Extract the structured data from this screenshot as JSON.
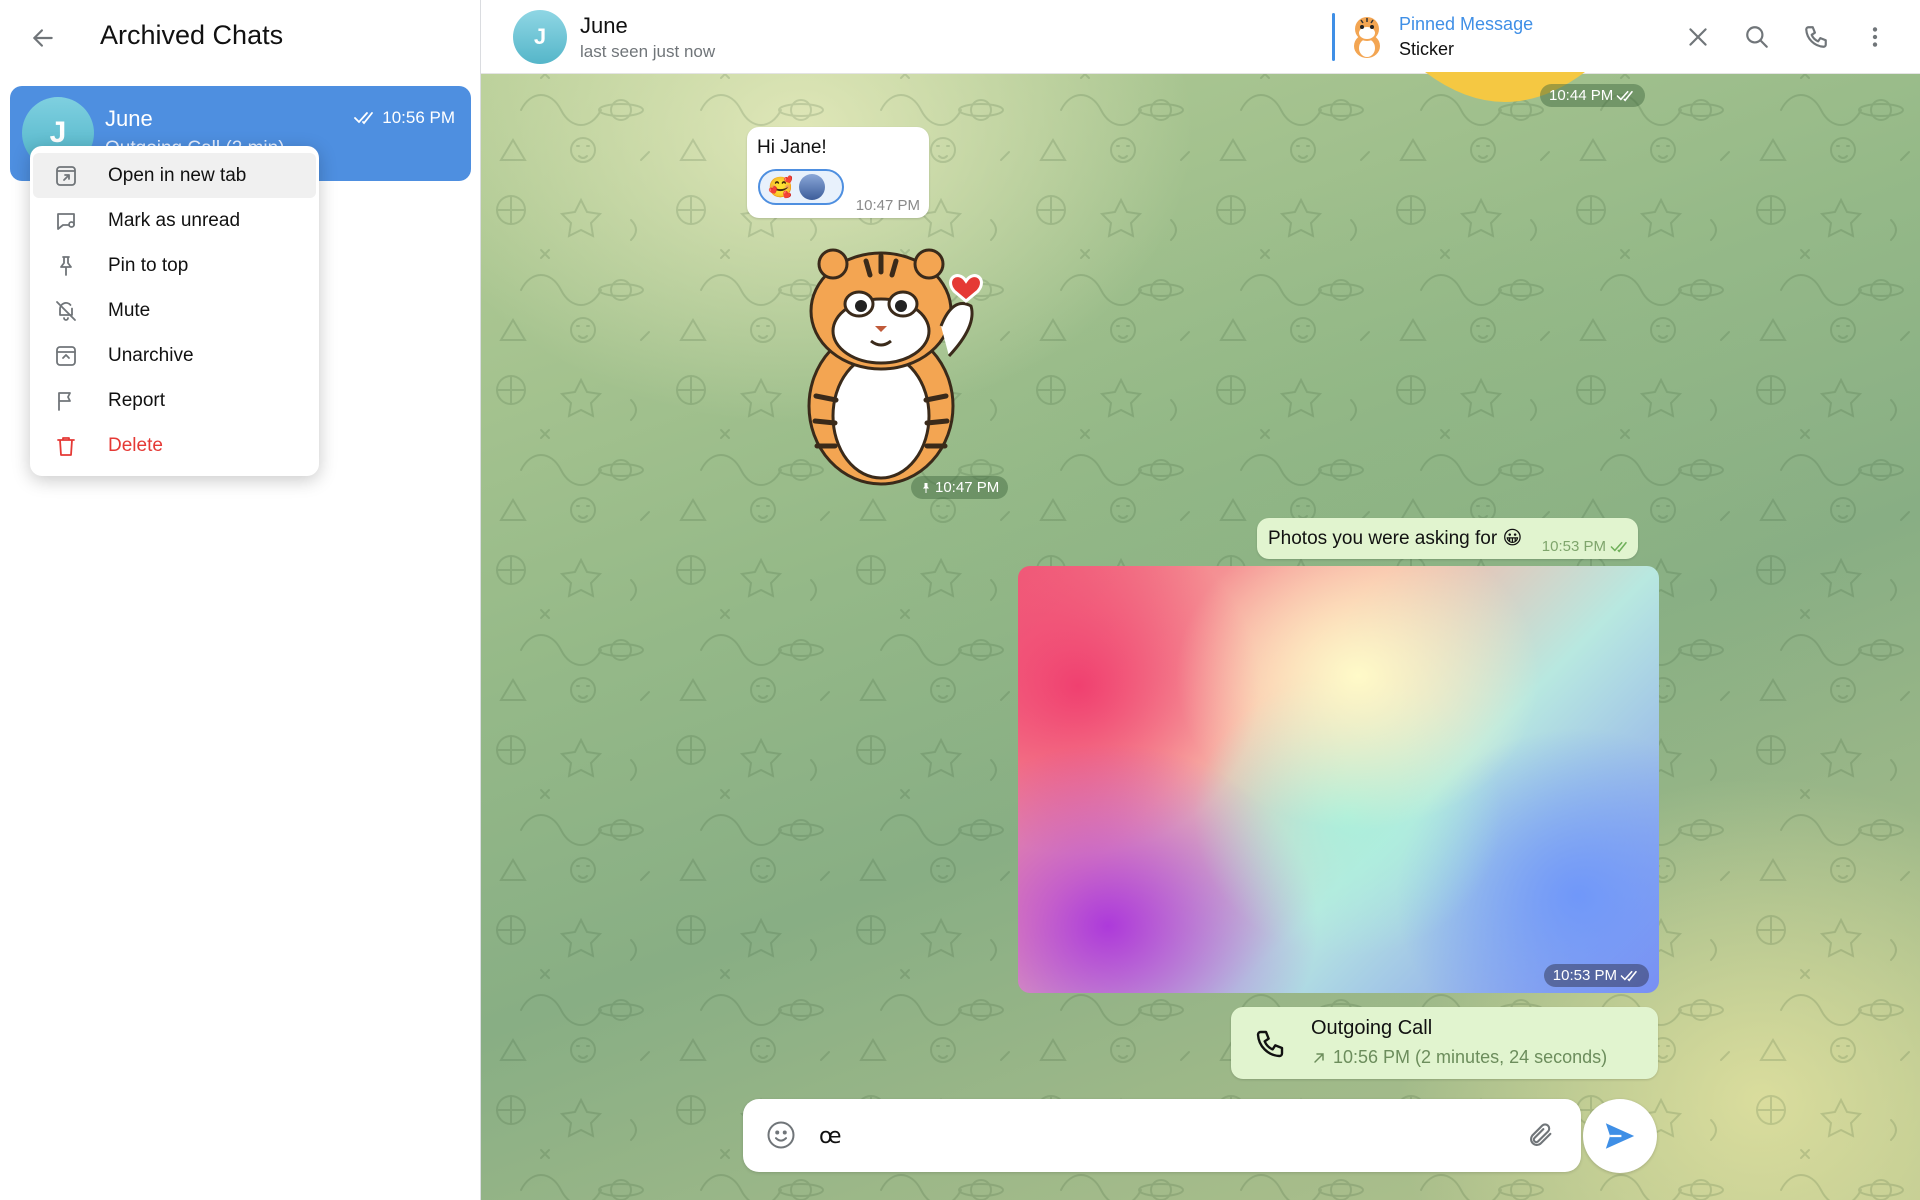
{
  "sidebar": {
    "title": "Archived Chats",
    "chat": {
      "avatar_letter": "J",
      "name": "June",
      "time": "10:56 PM",
      "preview": "Outgoing Call (2 min)"
    },
    "context_menu": [
      {
        "label": "Open in new tab",
        "icon": "open-new-tab-icon"
      },
      {
        "label": "Mark as unread",
        "icon": "mark-unread-icon"
      },
      {
        "label": "Pin to top",
        "icon": "pin-icon"
      },
      {
        "label": "Mute",
        "icon": "mute-bell-icon"
      },
      {
        "label": "Unarchive",
        "icon": "unarchive-icon"
      },
      {
        "label": "Report",
        "icon": "flag-icon"
      },
      {
        "label": "Delete",
        "icon": "trash-icon"
      }
    ]
  },
  "header": {
    "avatar_letter": "J",
    "name": "June",
    "status": "last seen just now",
    "pinned_title": "Pinned Message",
    "pinned_text": "Sticker"
  },
  "messages": {
    "top_sticker_time": "10:44 PM",
    "greeting_text": "Hi Jane!",
    "greeting_time": "10:47 PM",
    "reaction_emoji": "🥰",
    "sticker_time": "10:47 PM",
    "photos_caption": "Photos you were asking for 😀",
    "photos_caption_time": "10:53 PM",
    "photo_time": "10:53 PM",
    "call_title": "Outgoing Call",
    "call_detail": "10:56 PM (2 minutes, 24 seconds)"
  },
  "composer": {
    "value": "œ"
  },
  "colors": {
    "accent": "#3f8fe6",
    "selected_chat": "#4e8fe0",
    "danger": "#e53935",
    "outgoing_bubble": "#e1f4cf"
  }
}
